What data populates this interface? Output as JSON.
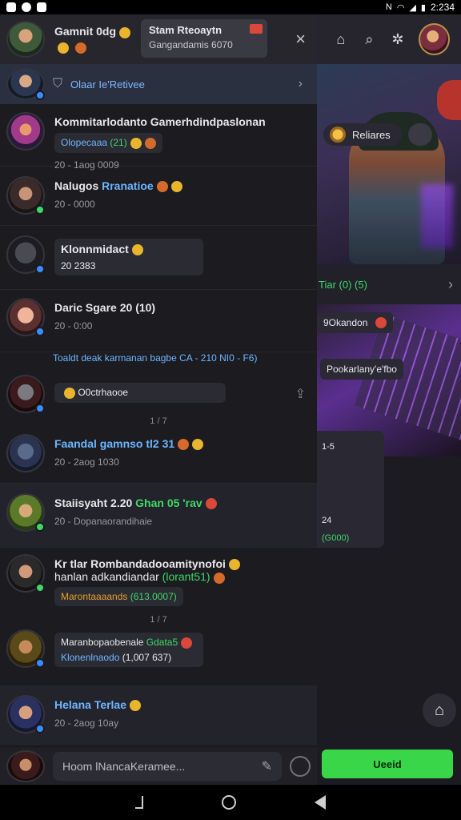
{
  "status_bar": {
    "time": "2:234"
  },
  "header": {
    "title": "Gamnit 0dg",
    "popup_title": "Stam Rteoaytn",
    "popup_sub": "Gangandamis 6070",
    "close_label": "×"
  },
  "banner": {
    "label": "Olaar Ie'Retivee",
    "chevron": "›"
  },
  "right_panel": {
    "pill_label": "Reliares",
    "strip_label": "Tiar (0) (5)",
    "chip1": "9Okandon",
    "chip2": "Pookarlany'e'fbo",
    "card_top": "1-5",
    "card_val": "24",
    "card_bottom": "(G000)",
    "cta_label": "Ueeid"
  },
  "conversations": [
    {
      "name": "Kommitarlodanto Gamerhdindpaslonan",
      "bubble": "Olopecaaa",
      "tag": "(21)",
      "time": "20 - 1aog 0009"
    },
    {
      "name": "Nalugos",
      "name_accent": "Rranatioe",
      "time": "20 - 0000"
    },
    {
      "name": "Klonnmidact",
      "bubble": "20 2383",
      "time": ""
    },
    {
      "name": "Daric Sgare 20",
      "tag": "(10)",
      "time": "20 - 0:00",
      "line2": "Toaldt deak karmanan bagbe CA - 210 NI0 - F6)"
    },
    {
      "name": "",
      "bubble": "O0ctrhaooe",
      "time": ""
    },
    {
      "name": "Faandal gamnso tl2 31",
      "time": "20 - 2aog 1030"
    },
    {
      "name": "Staiisyaht 2.20",
      "name_accent": "Ghan 05 'rav",
      "time": "20 - Dopanaorandihaie"
    },
    {
      "name": "Kr tlar Rombandadooamitynofoi",
      "line2": "hanlan adkandiandar",
      "tag": "(lorant51)",
      "bubble": "Marontaaaands",
      "bubble_tag": "(613.0007)",
      "time": ""
    },
    {
      "name": "",
      "bubble": "Maranbopaobenale",
      "tag": "Gdata5",
      "bubble2": "Klonenlnaodo",
      "bubble2_tag": "(1,007 637)",
      "time": ""
    },
    {
      "name": "Helana Terlae",
      "time": "20 - 2aog 10ay"
    }
  ],
  "separator1": "1 / 7",
  "separator2": "1 / 7",
  "input": {
    "placeholder": "Hoom lNancaKeramee..."
  }
}
